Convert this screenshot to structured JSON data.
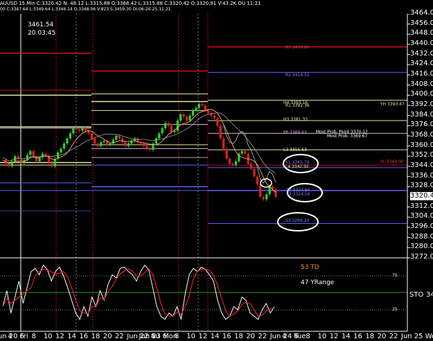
{
  "header": {
    "line1": "AUUSD 15.Min C:3320.42 N: 48.12 L:3315.88 O:3368.42 L:3315.88 C:3320.42 O:3320.91 V:43.2K OU 11:21",
    "line2": "00 C:3347.64 L:3349.64 L:3346.14 O:3348.06 V:823 S:3459.30 OI:06-20-25 11:21"
  },
  "price_box": {
    "value": "3461.54",
    "time": "20 03:45"
  },
  "current_price": "3320.4",
  "y_axis": {
    "labels": [
      "3464.0",
      "3456.0",
      "3448.0",
      "3440.0",
      "3432.0",
      "3424.0",
      "3416.0",
      "3408.0",
      "3400.0",
      "3392.0",
      "3384.0",
      "3376.0",
      "3368.0",
      "3360.0",
      "3352.0",
      "3344.0",
      "3336.0",
      "3328.0",
      "3312.0",
      "3304.0",
      "3296.0",
      "3288.0",
      "3280.0",
      "3272.0"
    ],
    "min": 3272,
    "max": 3464
  },
  "x_axis": {
    "labels": [
      "Jun 20 Fri",
      "4",
      "6",
      "8",
      "10",
      "12",
      "14",
      "16",
      "18",
      "20",
      "22",
      "Jun 22 Su",
      "Jun 23 Mon",
      "4",
      "6",
      "8",
      "10",
      "12",
      "14",
      "16",
      "18",
      "20",
      "22",
      "Jun 24 Tue",
      "4",
      "6",
      "8",
      "10",
      "12",
      "14",
      "16",
      "18",
      "20",
      "22",
      "Jun 25 Wed"
    ]
  },
  "pivot_labels": {
    "r3": "R3 3430.87",
    "r2": "R2 3414.52",
    "h4": "H4 3393.16",
    "r1": "R1 3392.36",
    "yh": "YH 3393.47",
    "h3": "H3 3381.35",
    "pp": "PP 3369.63",
    "most_probable": "Most Prob. Point 3370.17",
    "most_probable2": "Most Prob. 3369.67",
    "l3": "L3 3355.63",
    "s1": "S1 3345.79",
    "l4": "L4 3342.92",
    "yl": "YL 3340.00",
    "s2": "S2 3327.84",
    "s2b": "S2 3324.56",
    "s3": "S3 3299.20"
  },
  "oscillator": {
    "td_label": "53 TD",
    "yrange_label": "47 YRange",
    "sto_label": "STO",
    "sto_value": "34",
    "level_75": "75",
    "level_25": "25"
  },
  "chart_data": {
    "type": "line",
    "title": "AUUSD 15.Min",
    "xlabel": "",
    "ylabel": "",
    "ylim": [
      3272,
      3464
    ],
    "series": [
      {
        "values": [
          3349,
          3346,
          3344,
          3348,
          3352,
          3350,
          3347,
          3349,
          3353,
          3356,
          3352,
          3348,
          3351,
          3354,
          3352,
          3347,
          3344,
          3350,
          3355,
          3358,
          3362,
          3366,
          3370,
          3374,
          3373,
          3372,
          3374,
          3372,
          3370,
          3366,
          3362,
          3360,
          3363,
          3364,
          3361,
          3362,
          3365,
          3368,
          3366,
          3363,
          3360,
          3362,
          3364,
          3366,
          3363,
          3362,
          3360,
          3358,
          3357,
          3362,
          3366,
          3370,
          3374,
          3378,
          3376,
          3371,
          3372,
          3380,
          3385,
          3383,
          3380,
          3384,
          3388,
          3390,
          3393,
          3392,
          3388,
          3386,
          3384,
          3382,
          3376,
          3366,
          3358,
          3350,
          3346,
          3345,
          3348,
          3354,
          3356,
          3354,
          3346,
          3342,
          3336,
          3330,
          3320,
          3318,
          3322,
          3328,
          3326,
          3320
        ]
      }
    ]
  },
  "colors": {
    "r_line": "#d01010",
    "h_line": "#e6e6a0",
    "h3_line": "#e6e6a0",
    "pp_line": "#d8b0d8",
    "s_line": "#6060ff",
    "ma_line": "#e0a060",
    "candle_up": "#2ad42a",
    "candle_down": "#e02020",
    "k_line": "#ffffff",
    "d_line": "#e02020"
  }
}
